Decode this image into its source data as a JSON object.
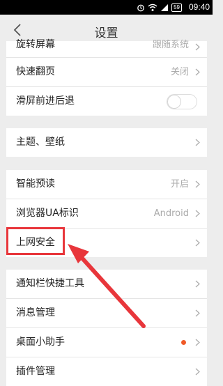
{
  "status_bar": {
    "time": "09:40",
    "battery": "59"
  },
  "header": {
    "title": "设置"
  },
  "groups": [
    {
      "rows": [
        {
          "label": "旋转屏幕",
          "value": "跟随系统"
        },
        {
          "label": "快速翻页",
          "value": "关闭"
        },
        {
          "label": "滑屏前进后退",
          "toggle": false
        }
      ]
    },
    {
      "rows": [
        {
          "label": "主题、壁纸"
        }
      ]
    },
    {
      "rows": [
        {
          "label": "智能预读",
          "value": "开启"
        },
        {
          "label": "浏览器UA标识",
          "value": "Android"
        },
        {
          "label": "上网安全"
        }
      ]
    },
    {
      "rows": [
        {
          "label": "通知栏快捷工具"
        },
        {
          "label": "消息管理"
        },
        {
          "label": "桌面小助手",
          "badge": true
        },
        {
          "label": "插件管理"
        }
      ]
    }
  ],
  "colors": {
    "highlight": "#e8363b",
    "badge": "#f05a28"
  }
}
